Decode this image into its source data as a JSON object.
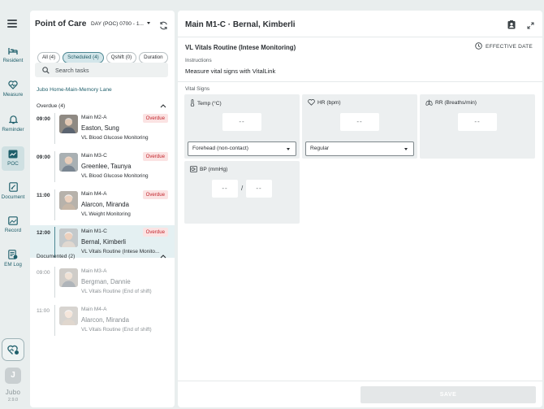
{
  "rail": {
    "items": [
      {
        "label": "Resident",
        "icon": "bed-icon"
      },
      {
        "label": "Measure",
        "icon": "heart-pulse-icon"
      },
      {
        "label": "Reminder",
        "icon": "bell-icon"
      },
      {
        "label": "POC",
        "icon": "chart-icon",
        "active": true
      },
      {
        "label": "Document",
        "icon": "document-icon"
      },
      {
        "label": "Record",
        "icon": "record-icon"
      },
      {
        "label": "EM Log",
        "icon": "emlog-icon"
      }
    ],
    "avatar_initial": "J",
    "brand": "Jubo",
    "version": "2.9.0"
  },
  "tasks_panel": {
    "title": "Point of Care",
    "shift": "DAY (POC) 0700 - 1...",
    "filters": [
      "All (4)",
      "Scheduled (4)",
      "Qshift (0)",
      "Duration"
    ],
    "active_filter": 1,
    "search_placeholder": "Search tasks",
    "facility": "Jubo Home-Main-Memory Lane",
    "overdue_header": "Overdue (4)",
    "documented_header": "Documented (2)",
    "overdue": [
      {
        "time": "09:00",
        "room": "Main M2-A",
        "name": "Easton, Sung",
        "desc": "VL Blood Glucose Monitoring",
        "badge": "Overdue"
      },
      {
        "time": "09:00",
        "room": "Main M3-C",
        "name": "Greenlee, Taunya",
        "desc": "VL Blood Glucose Monitoring",
        "badge": "Overdue"
      },
      {
        "time": "11:00",
        "room": "Main M4-A",
        "name": "Alarcon, Miranda",
        "desc": "VL Weight Monitoring",
        "badge": "Overdue"
      },
      {
        "time": "12:00",
        "room": "Main M1-C",
        "name": "Bernal, Kimberli",
        "desc": "VL Vitals Routine (Intese Monito...",
        "badge": "Overdue"
      }
    ],
    "documented": [
      {
        "time": "09:00",
        "room": "Main M3-A",
        "name": "Bergman, Dannie",
        "desc": "VL Vitals Routine (End of shift)"
      },
      {
        "time": "11:00",
        "room": "Main M4-A",
        "name": "Alarcon, Miranda",
        "desc": "VL Vitals Routine (End of shift)"
      }
    ]
  },
  "detail": {
    "title": "Main M1-C · Bernal, Kimberli",
    "task_name": "VL Vitals Routine (Intese Monitoring)",
    "effective_date": "EFFECTIVE DATE",
    "instructions_label": "Instructions",
    "instructions": "Measure vital signs with VitalLink",
    "vitals_label": "Vital Signs",
    "temp_label": "Temp (°C)",
    "hr_label": "HR (bpm)",
    "rr_label": "RR (Breaths/min)",
    "bp_label": "BP (mmHg)",
    "empty_value": "--",
    "temp_method": "Forehead (non-contact)",
    "hr_rhythm": "Regular",
    "bp_separator": "/",
    "save_label": "SAVE"
  },
  "colors": {
    "accent": "#1f5f6b",
    "overdue": "#c2262d",
    "selected_bg": "#e4f0f2"
  }
}
